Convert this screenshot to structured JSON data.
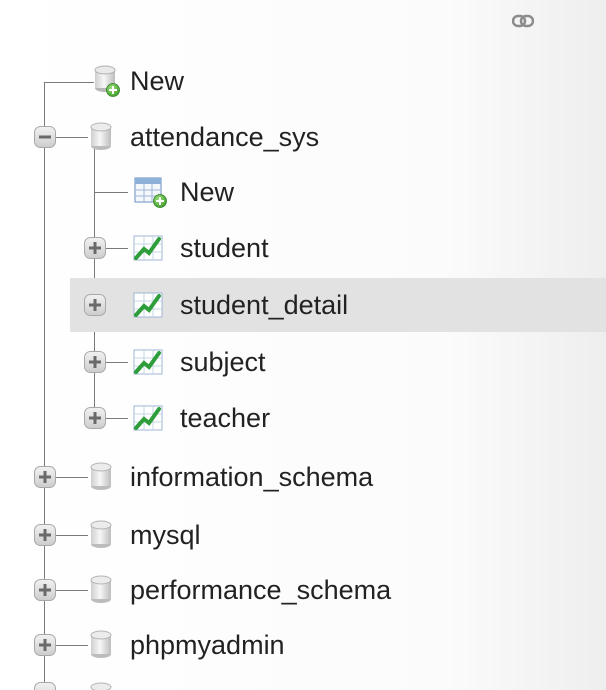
{
  "nav_tree": {
    "top_new_label": "New",
    "databases": [
      {
        "name": "attendance_sys",
        "expanded": true,
        "children": {
          "new_label": "New",
          "tables": [
            "student",
            "student_detail",
            "subject",
            "teacher"
          ],
          "highlighted_table": "student_detail"
        }
      },
      {
        "name": "information_schema",
        "expanded": false
      },
      {
        "name": "mysql",
        "expanded": false
      },
      {
        "name": "performance_schema",
        "expanded": false
      },
      {
        "name": "phpmyadmin",
        "expanded": false
      }
    ]
  },
  "icons": {
    "toolbar": "link-icon",
    "database": "database-icon",
    "new_database": "database-new-icon",
    "new_table": "table-new-icon",
    "table": "table-icon",
    "expand": "plus-expander",
    "collapse": "minus-expander"
  },
  "colors": {
    "highlight_row": "#e2e2e2",
    "tree_line": "#7a7a7a",
    "table_icon_green": "#2e9e3a",
    "new_badge_green": "#4caf3c",
    "text": "#222222"
  }
}
